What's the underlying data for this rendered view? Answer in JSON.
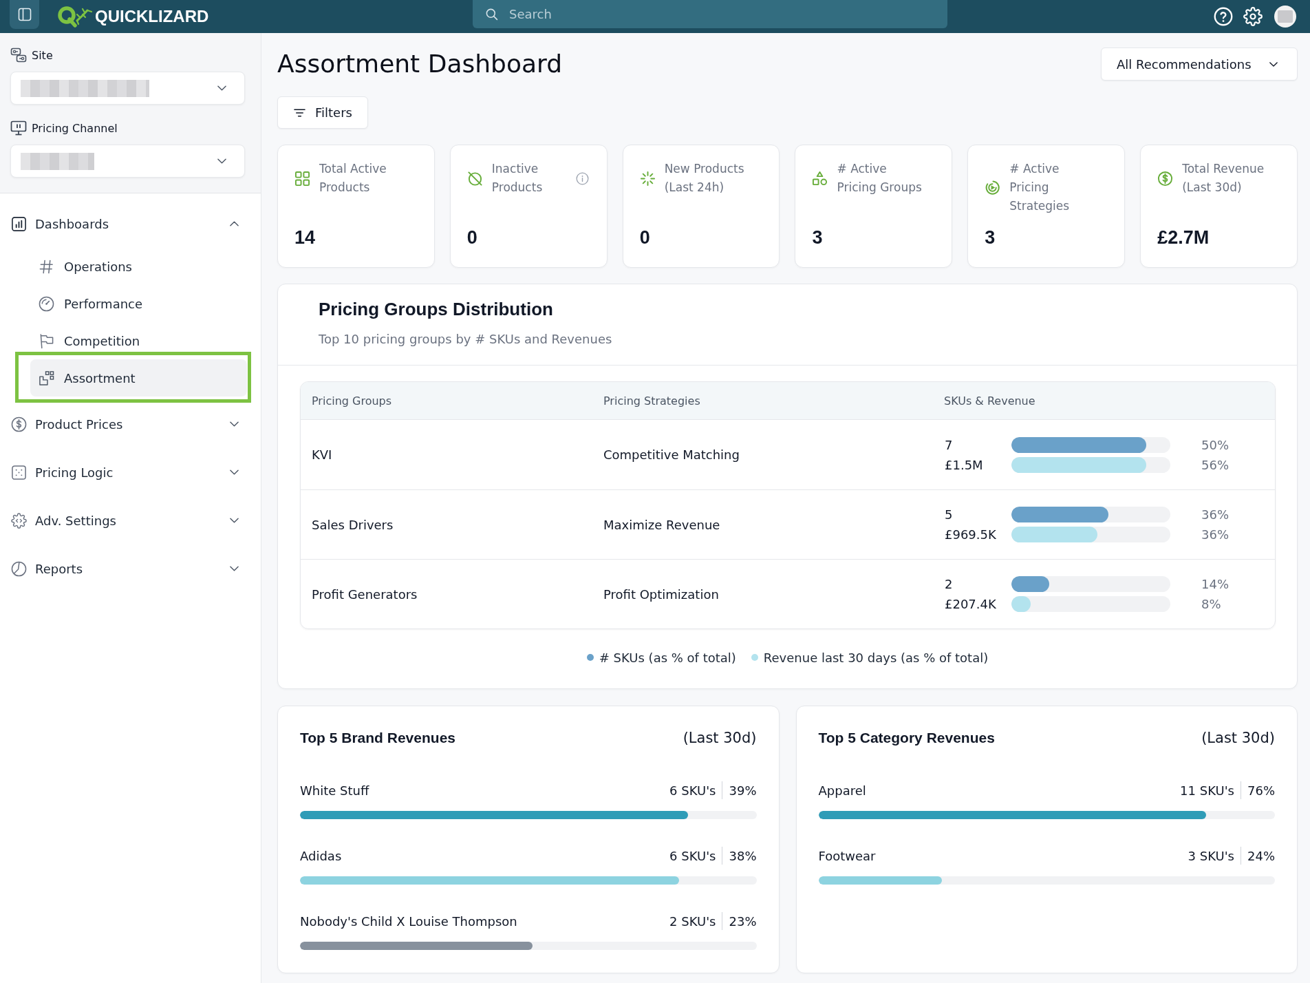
{
  "top_bar": {
    "brand": "QUICKLIZARD",
    "search": {
      "placeholder": "Search"
    }
  },
  "sidebar": {
    "filters": [
      {
        "label": "Site"
      },
      {
        "label": "Pricing Channel"
      }
    ],
    "nav": [
      {
        "label": "Dashboards",
        "expanded": true,
        "children": [
          {
            "label": "Operations",
            "selected": false,
            "highlighted": false
          },
          {
            "label": "Performance",
            "selected": false,
            "highlighted": false
          },
          {
            "label": "Competition",
            "selected": false,
            "highlighted": false
          },
          {
            "label": "Assortment",
            "selected": true,
            "highlighted": true
          }
        ]
      },
      {
        "label": "Product Prices",
        "expanded": false
      },
      {
        "label": "Pricing Logic",
        "expanded": false
      },
      {
        "label": "Adv. Settings",
        "expanded": false
      },
      {
        "label": "Reports",
        "expanded": false
      }
    ]
  },
  "header": {
    "title": "Assortment Dashboard",
    "view_select": {
      "value": "All Recommendations"
    },
    "filters_button": {
      "label": "Filters"
    }
  },
  "kpis": [
    {
      "label_lines": [
        "Total Active",
        "Products"
      ],
      "value": "14",
      "info": false
    },
    {
      "label_lines": [
        "Inactive",
        "Products"
      ],
      "value": "0",
      "info": true
    },
    {
      "label_lines": [
        "New Products",
        "(Last 24h)"
      ],
      "value": "0",
      "info": false
    },
    {
      "label_lines": [
        "# Active",
        "Pricing Groups"
      ],
      "value": "3",
      "info": false
    },
    {
      "label_lines": [
        "# Active",
        "Pricing",
        "Strategies"
      ],
      "value": "3",
      "info": false
    },
    {
      "label_lines": [
        "Total Revenue",
        "(Last 30d)"
      ],
      "value": "£2.7M",
      "info": false
    }
  ],
  "distribution": {
    "title": "Pricing Groups Distribution",
    "subtitle": "Top 10 pricing groups by # SKUs and Revenues",
    "table": {
      "columns": [
        "Pricing Groups",
        "Pricing Strategies",
        "SKUs & Revenue"
      ],
      "rows": [
        {
          "group": "KVI",
          "strategy": "Competitive Matching",
          "skus": {
            "value": "7",
            "level": 0.85,
            "share": "50%"
          },
          "revenue": {
            "value": "£1.5M",
            "level": 0.85,
            "share": "56%"
          }
        },
        {
          "group": "Sales Drivers",
          "strategy": "Maximize Revenue",
          "skus": {
            "value": "5",
            "level": 0.61,
            "share": "36%"
          },
          "revenue": {
            "value": "£969.5K",
            "level": 0.54,
            "share": "36%"
          }
        },
        {
          "group": "Profit Generators",
          "strategy": "Profit Optimization",
          "skus": {
            "value": "2",
            "level": 0.24,
            "share": "14%"
          },
          "revenue": {
            "value": "£207.4K",
            "level": 0.12,
            "share": "8%"
          }
        }
      ]
    },
    "legend": [
      {
        "label": "# SKUs (as % of total)",
        "color": "#6aa1c9"
      },
      {
        "label": "Revenue last 30 days (as % of total)",
        "color": "#b3e3ee"
      }
    ]
  },
  "brand_revenues": {
    "title": "Top 5 Brand Revenues",
    "period": "(Last 30d)",
    "items": [
      {
        "name": "White Stuff",
        "skus": "6 SKU's",
        "share": "39%",
        "level": 0.85,
        "color": "#2f9cb7"
      },
      {
        "name": "Adidas",
        "skus": "6 SKU's",
        "share": "38%",
        "level": 0.83,
        "color": "#8dd3e0"
      },
      {
        "name": "Nobody's Child X Louise Thompson",
        "skus": "2 SKU's",
        "share": "23%",
        "level": 0.51,
        "color": "#87919d"
      }
    ]
  },
  "category_revenues": {
    "title": "Top 5 Category Revenues",
    "period": "(Last 30d)",
    "items": [
      {
        "name": "Apparel",
        "skus": "11 SKU's",
        "share": "76%",
        "level": 0.85,
        "color": "#2f9cb7"
      },
      {
        "name": "Footwear",
        "skus": "3 SKU's",
        "share": "24%",
        "level": 0.27,
        "color": "#8dd3e0"
      }
    ]
  }
}
